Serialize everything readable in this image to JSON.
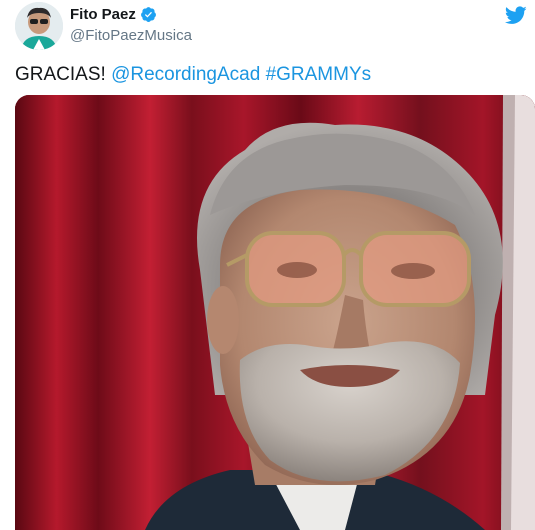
{
  "author": {
    "display_name": "Fito Paez",
    "handle": "@FitoPaezMusica",
    "verified": true
  },
  "tweet": {
    "text_prefix": "GRACIAS! ",
    "mention": "@RecordingAcad",
    "separator": " ",
    "hashtag": "#GRAMMYs"
  },
  "colors": {
    "link": "#1b95e0",
    "twitter_blue": "#1da1f2",
    "handle_gray": "#657786"
  },
  "icons": {
    "brand": "twitter-bird-icon",
    "verified": "verified-badge-icon"
  }
}
